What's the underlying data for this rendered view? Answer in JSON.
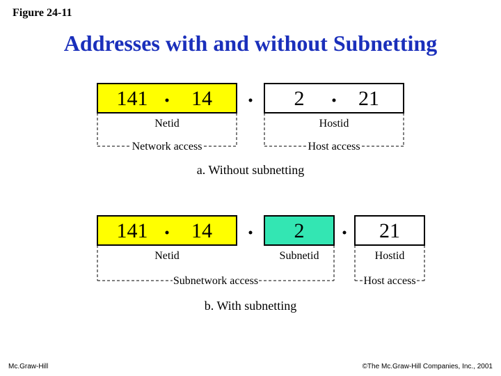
{
  "figure_label": "Figure 24-11",
  "title": "Addresses with and without Subnetting",
  "diagramA": {
    "octets": [
      "141",
      "14",
      "2",
      "21"
    ],
    "netid": "Netid",
    "hostid": "Hostid",
    "network_access": "Network access",
    "host_access": "Host access",
    "caption": "a. Without subnetting"
  },
  "diagramB": {
    "octets": [
      "141",
      "14",
      "2",
      "21"
    ],
    "netid": "Netid",
    "subnetid": "Subnetid",
    "hostid": "Hostid",
    "subnetwork_access": "Subnetwork access",
    "host_access": "Host access",
    "caption": "b. With subnetting"
  },
  "footer_left": "Mc.Graw-Hill",
  "footer_right": "©The Mc.Graw-Hill Companies, Inc., 2001"
}
